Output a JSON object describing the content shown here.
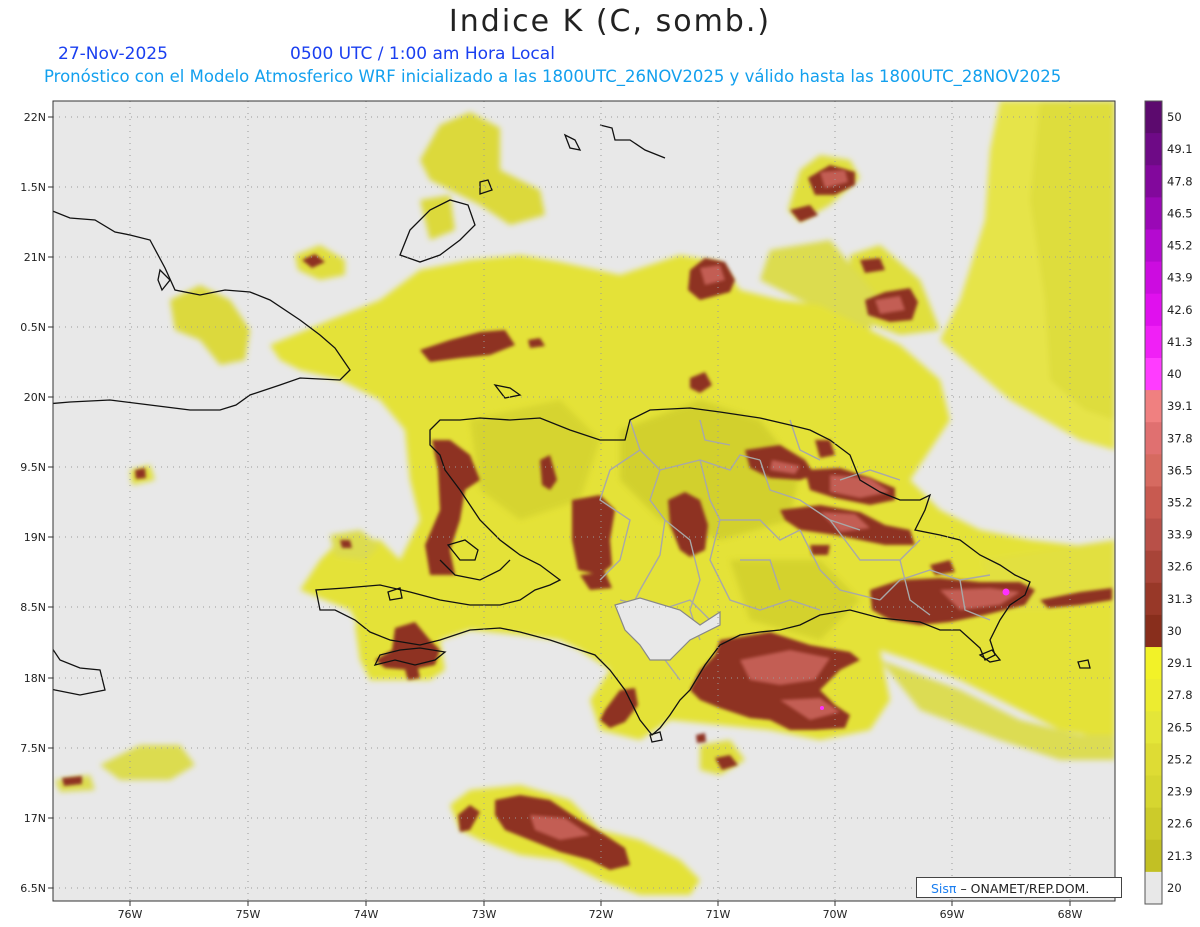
{
  "title": "Indice K (C, somb.)",
  "date": "27-Nov-2025",
  "time": "0500 UTC / 1:00 am Hora Local",
  "subtitle": "Pronóstico con el Modelo Atmosferico WRF inicializado a las 1800UTC_26NOV2025 y válido hasta las  1800UTC_28NOV2025",
  "credit": {
    "brand": "Sisπ",
    "org": "– ONAMET/REP.DOM."
  },
  "lat_labels": [
    "22N",
    "1.5N",
    "21N",
    "0.5N",
    "20N",
    "9.5N",
    "19N",
    "8.5N",
    "18N",
    "7.5N",
    "17N",
    "6.5N"
  ],
  "lon_labels": [
    "76W",
    "75W",
    "74W",
    "73W",
    "72W",
    "71W",
    "70W",
    "69W",
    "68W"
  ],
  "colorbar": {
    "labels": [
      "50",
      "49.1",
      "47.8",
      "46.5",
      "45.2",
      "43.9",
      "42.6",
      "41.3",
      "40",
      "39.1",
      "37.8",
      "36.5",
      "35.2",
      "33.9",
      "32.6",
      "31.3",
      "30",
      "29.1",
      "27.8",
      "26.5",
      "25.2",
      "23.9",
      "22.6",
      "21.3",
      "20"
    ],
    "colors": [
      "#5c0a6e",
      "#6e0a86",
      "#82089c",
      "#9a08b6",
      "#b40ad0",
      "#cc0ce0",
      "#e010ee",
      "#f020f6",
      "#ff3cff",
      "#f08080",
      "#e07070",
      "#d66a60",
      "#c85a50",
      "#b85048",
      "#a84438",
      "#983828",
      "#882e1c",
      "#f2f228",
      "#ecec30",
      "#e4e638",
      "#dedc34",
      "#d6d630",
      "#cccb2a",
      "#c2c024",
      "#e8e8e8"
    ]
  },
  "colors": {
    "background": "#e8e8e8",
    "yellow": "#e4e238",
    "yellow_dark": "#cdc92a",
    "yellow_light": "#ebe878",
    "brown": "#8e3322",
    "salmon": "#c9645a",
    "coast": "#111111",
    "provinces": "#a8a8a8"
  }
}
